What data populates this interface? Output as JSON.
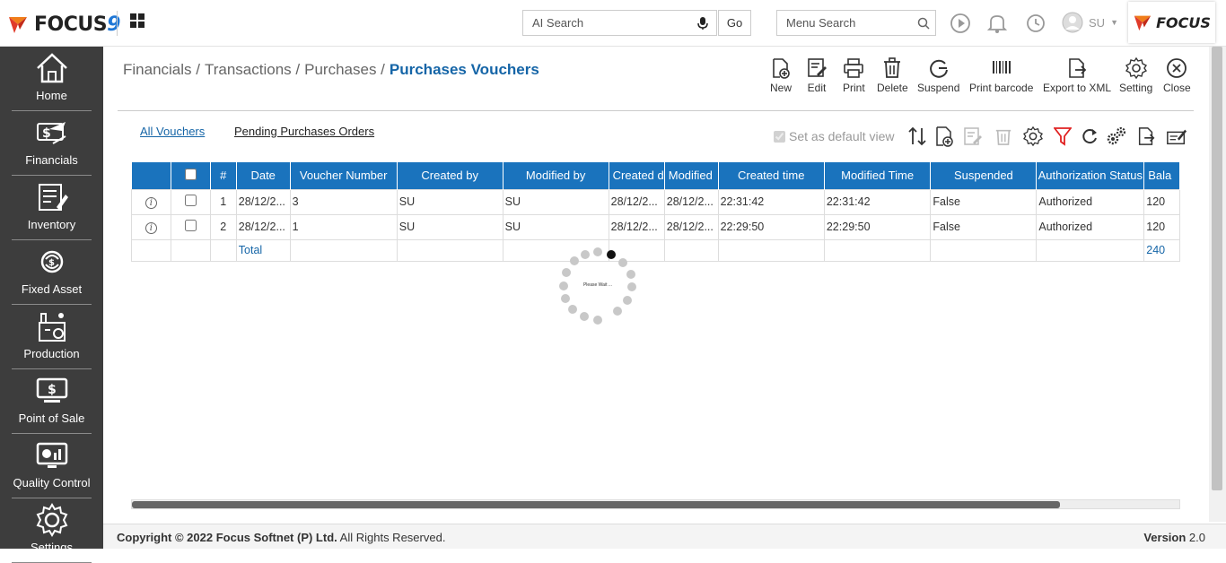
{
  "header": {
    "logo_text": "FOCUS",
    "logo_number": "9",
    "ai_search_placeholder": "AI Search",
    "go_label": "Go",
    "menu_search_placeholder": "Menu Search",
    "user_name": "SU",
    "brand_text": "FOCUS"
  },
  "sidebar": {
    "items": [
      {
        "label": "Home",
        "icon": "home-icon"
      },
      {
        "label": "Financials",
        "icon": "financials-icon"
      },
      {
        "label": "Inventory",
        "icon": "inventory-icon"
      },
      {
        "label": "Fixed Asset",
        "icon": "fixed-asset-icon"
      },
      {
        "label": "Production",
        "icon": "production-icon"
      },
      {
        "label": "Point of Sale",
        "icon": "point-of-sale-icon"
      },
      {
        "label": "Quality Control",
        "icon": "quality-control-icon"
      },
      {
        "label": "Settings",
        "icon": "settings-icon"
      }
    ]
  },
  "breadcrumb": {
    "items": [
      "Financials /",
      "Transactions /",
      "Purchases /"
    ],
    "current": "Purchases Vouchers"
  },
  "toolbar": {
    "new": "New",
    "edit": "Edit",
    "print": "Print",
    "delete": "Delete",
    "suspend": "Suspend",
    "print_barcode": "Print barcode",
    "export_xml": "Export to XML",
    "setting": "Setting",
    "close": "Close"
  },
  "tabs": {
    "all_vouchers": "All Vouchers",
    "pending_orders": "Pending Purchases Orders"
  },
  "default_view_label": "Set as default view",
  "table": {
    "columns": [
      "#",
      "Date",
      "Voucher Number",
      "Created by",
      "Modified by",
      "Created d",
      "Modified",
      "Created time",
      "Modified Time",
      "Suspended",
      "Authorization Status",
      "Bala"
    ],
    "rows": [
      {
        "num": "1",
        "date": "28/12/2...",
        "voucher": "3",
        "created_by": "SU",
        "modified_by": "SU",
        "created_d": "28/12/2...",
        "modified": "28/12/2...",
        "created_time": "22:31:42",
        "modified_time": "22:31:42",
        "suspended": "False",
        "auth": "Authorized",
        "balance": "120"
      },
      {
        "num": "2",
        "date": "28/12/2...",
        "voucher": "1",
        "created_by": "SU",
        "modified_by": "SU",
        "created_d": "28/12/2...",
        "modified": "28/12/2...",
        "created_time": "22:29:50",
        "modified_time": "22:29:50",
        "suspended": "False",
        "auth": "Authorized",
        "balance": "120"
      }
    ],
    "total_label": "Total",
    "total_balance": "240"
  },
  "loader_text": "Please Wait ...",
  "footer": {
    "copyright_prefix": "Copyright © 2022 Focus Softnet (P) Ltd.",
    "copyright_suffix": " All Rights Reserved.",
    "version_label": "Version",
    "version_value": "2.0"
  }
}
